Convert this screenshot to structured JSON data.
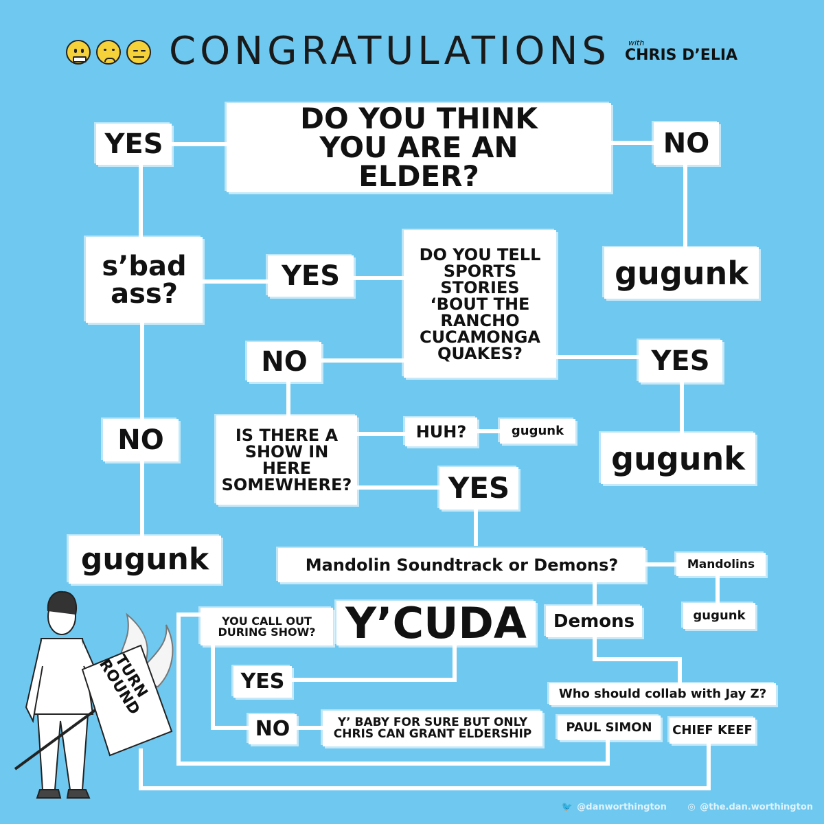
{
  "header": {
    "title": "CONGRATULATIONS",
    "with_label": "with",
    "host": "CHRIS D’ELIA"
  },
  "nodes": {
    "q_elder": "DO YOU THINK YOU ARE AN ELDER?",
    "yes_top": "YES",
    "no_top": "NO",
    "gugunk_right": "gugunk",
    "sbad_ass": "s’bad ass?",
    "yes_mid": "YES",
    "q_sports": "DO YOU TELL SPORTS STORIES ‘BOUT THE RANCHO CUCAMONGA QUAKES?",
    "no_mid": "NO",
    "yes_right": "YES",
    "gugunk_right2": "gugunk",
    "q_show": "IS THERE A SHOW IN HERE SOMEWHERE?",
    "huh": "HUH?",
    "gugunk_small1": "gugunk",
    "yes_show": "YES",
    "no_left": "NO",
    "gugunk_left": "gugunk",
    "q_mandolin": "Mandolin Soundtrack or Demons?",
    "mandolins": "Mandolins",
    "gugunk_small2": "gugunk",
    "demons": "Demons",
    "ycuda": "Y’CUDA",
    "q_callout": "YOU CALL OUT DURING SHOW?",
    "yes_callout": "YES",
    "no_callout": "NO",
    "baby": "Y’ BABY FOR SURE BUT ONLY CHRIS CAN GRANT ELDERSHIP",
    "q_jayz": "Who should collab with Jay Z?",
    "paul_simon": "PAUL SIMON",
    "chief_keef": "CHIEF KEEF",
    "sign": "TURN ROUND"
  },
  "credits": {
    "twitter": "@danworthington",
    "instagram": "@the.dan.worthington"
  },
  "colors": {
    "background": "#6ec8ef",
    "box": "#ffffff",
    "text": "#111111"
  }
}
